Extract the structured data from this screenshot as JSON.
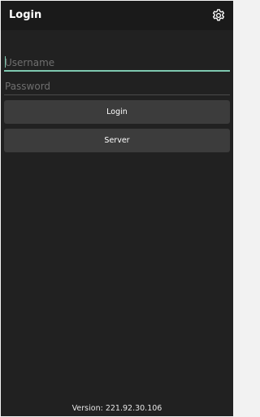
{
  "appbar": {
    "title": "Login",
    "settings_icon": "gear-icon"
  },
  "form": {
    "username": {
      "placeholder": "Username",
      "value": ""
    },
    "password": {
      "placeholder": "Password",
      "value": ""
    },
    "login_label": "Login",
    "server_label": "Server"
  },
  "footer": {
    "version_text": "Version: 221.92.30.106"
  },
  "colors": {
    "background": "#212121",
    "appbar": "#1a1a1a",
    "button": "#3c3c3c",
    "accent": "#7ec8b0",
    "text": "#ffffff",
    "placeholder": "#6f6f6f"
  }
}
